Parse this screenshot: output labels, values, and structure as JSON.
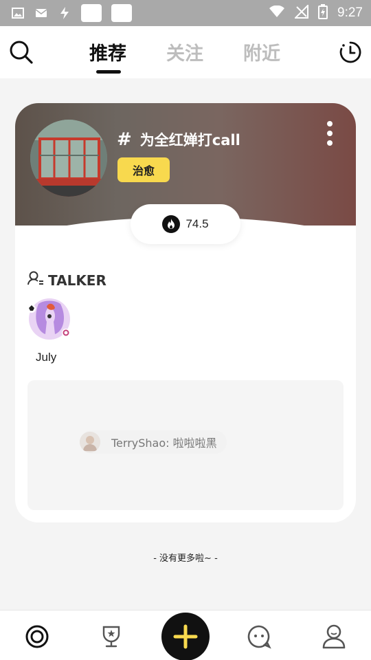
{
  "status_bar": {
    "time": "9:27",
    "left_icons": [
      "image-icon",
      "mail-icon",
      "flash-icon"
    ],
    "right_icons": [
      "wifi-icon",
      "no-signal-icon",
      "battery-icon"
    ]
  },
  "top_nav": {
    "tabs": [
      {
        "label": "推荐",
        "active": true
      },
      {
        "label": "关注",
        "active": false
      },
      {
        "label": "附近",
        "active": false
      }
    ],
    "left_icon": "search-icon",
    "right_icon": "history-clock-icon"
  },
  "topic_card": {
    "hash_symbol": "#",
    "title": "为全红婵打call",
    "tag": "治愈",
    "heat_value": "74.5",
    "talker_label": "TALKER",
    "talker_name": "July",
    "comment": "TerryShao: 啦啦啦黑"
  },
  "footer_text": "- 没有更多啦~ -",
  "bottom_nav": {
    "items": [
      "home-icon",
      "trophy-icon",
      "add-icon",
      "chat-icon",
      "profile-icon"
    ],
    "accent_color": "#f8d94e"
  },
  "colors": {
    "tag_bg": "#f8d94e",
    "status_bar": "#a9a9a9",
    "active_tab": "#111111",
    "inactive_tab": "#bdbdbd"
  }
}
